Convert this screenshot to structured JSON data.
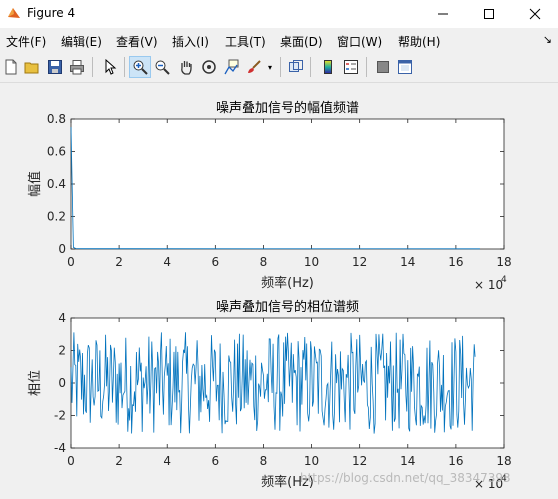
{
  "window": {
    "title": "Figure 4"
  },
  "menu": [
    {
      "label": "文件(F)"
    },
    {
      "label": "编辑(E)"
    },
    {
      "label": "查看(V)"
    },
    {
      "label": "插入(I)"
    },
    {
      "label": "工具(T)"
    },
    {
      "label": "桌面(D)"
    },
    {
      "label": "窗口(W)"
    },
    {
      "label": "帮助(H)"
    }
  ],
  "toolbar": {
    "icons": [
      "new-figure-icon",
      "open-file-icon",
      "save-icon",
      "print-icon",
      "edit-plot-icon",
      "zoom-in-icon",
      "zoom-out-icon",
      "pan-icon",
      "rotate-3d-icon",
      "data-cursor-icon",
      "brush-icon",
      "link-plot-icon",
      "colorbar-icon",
      "legend-icon",
      "hide-plot-tools-icon",
      "show-plot-tools-icon"
    ]
  },
  "watermark": "https://blog.csdn.net/qq_38347393",
  "chart_data": [
    {
      "type": "line",
      "title": "噪声叠加信号的幅值频谱",
      "xlabel": "频率(Hz)",
      "ylabel": "幅值",
      "xlim": [
        0,
        180000
      ],
      "ylim": [
        0,
        0.8
      ],
      "x_ticks": [
        "0",
        "2",
        "4",
        "6",
        "8",
        "10",
        "12",
        "14",
        "16",
        "18"
      ],
      "y_ticks": [
        "0",
        "0.2",
        "0.4",
        "0.6",
        "0.8"
      ],
      "x_exponent": "× 10",
      "x_exponent_power": "4",
      "color": "#0072bd",
      "series": [
        {
          "x": [
            0,
            1000,
            2000,
            5000,
            170000
          ],
          "values": [
            0.75,
            0.01,
            0.003,
            0.002,
            0.001
          ]
        }
      ]
    },
    {
      "type": "line",
      "title": "噪声叠加信号的相位谱频",
      "xlabel": "频率(Hz)",
      "ylabel": "相位",
      "xlim": [
        0,
        180000
      ],
      "ylim": [
        -4,
        4
      ],
      "x_ticks": [
        "0",
        "2",
        "4",
        "6",
        "8",
        "10",
        "12",
        "14",
        "16",
        "18"
      ],
      "y_ticks": [
        "-4",
        "-2",
        "0",
        "2",
        "4"
      ],
      "x_exponent": "× 10",
      "x_exponent_power": "4",
      "color": "#0072bd",
      "series": [
        {
          "x_range": [
            0,
            168000
          ],
          "value_range": [
            -3.14,
            3.14
          ],
          "pattern": "noise-phase"
        }
      ]
    }
  ]
}
